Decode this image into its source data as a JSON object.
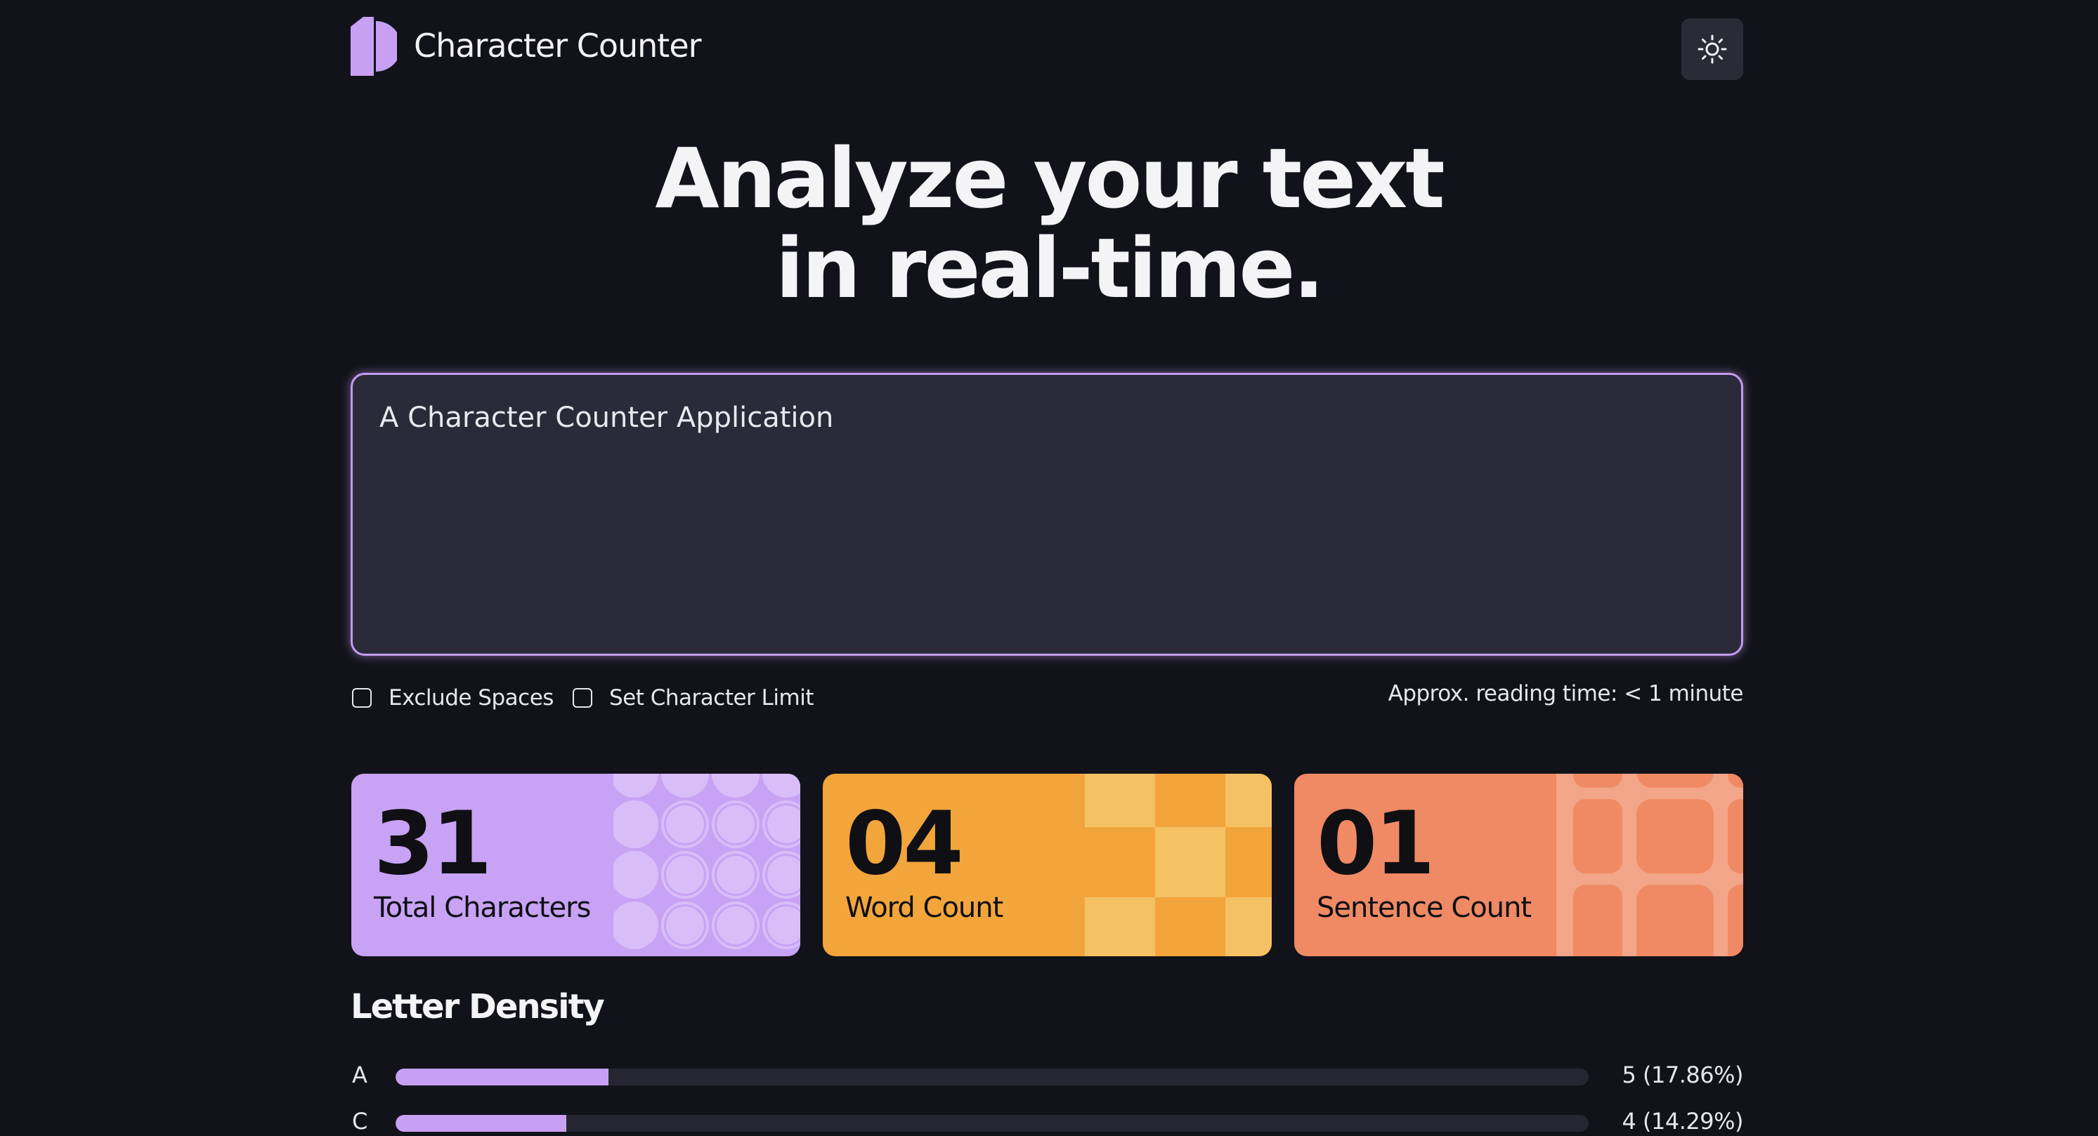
{
  "header": {
    "title": "Character Counter",
    "theme_toggle_icon": "sun-icon",
    "brand_color": "#c7a0f3"
  },
  "hero": {
    "line1": "Analyze your text",
    "line2": "in real-time."
  },
  "editor": {
    "value": "A Character Counter Application"
  },
  "options": {
    "exclude_spaces": {
      "label": "Exclude Spaces",
      "checked": false
    },
    "character_limit": {
      "label": "Set Character Limit",
      "checked": false
    },
    "reading_time": "Approx. reading time: < 1 minute"
  },
  "stats": [
    {
      "value": "31",
      "label": "Total Characters",
      "color": "#c8a2f4"
    },
    {
      "value": "04",
      "label": "Word Count",
      "color": "#f2a53b"
    },
    {
      "value": "01",
      "label": "Sentence Count",
      "color": "#ef8a64"
    }
  ],
  "density": {
    "title": "Letter Density",
    "rows": [
      {
        "letter": "A",
        "count": "5 (17.86%)",
        "percent": 17.86
      },
      {
        "letter": "C",
        "count": "4 (14.29%)",
        "percent": 14.29
      }
    ]
  }
}
